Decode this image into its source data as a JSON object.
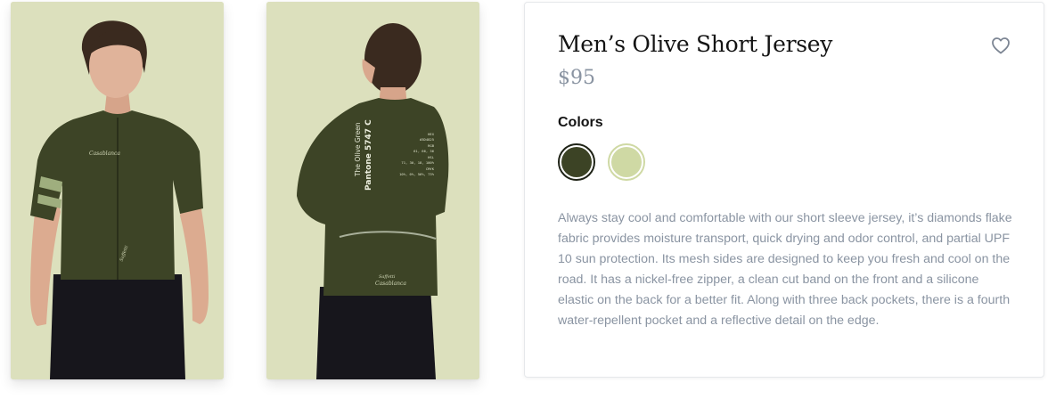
{
  "product": {
    "title": "Men’s Olive Short Jersey",
    "price": "$95",
    "colors_label": "Colors",
    "colors": [
      {
        "name": "olive",
        "hex": "#3c4325",
        "selected": true
      },
      {
        "name": "light-sage",
        "hex": "#cfd9a4",
        "selected": false
      }
    ],
    "description": "Always stay cool and comfortable with our short sleeve jersey, it’s diamonds flake fabric provides moisture transport, quick drying and odor control, and partial UPF 10 sun protection. Its mesh sides are designed to keep you fresh and cool on the road. It has a nickel-free zipper, a clean cut band on the front and a silicone elastic on the back for a better fit. Along with three back pockets, there is a fourth water-repellent pocket and a reflective detail on the edge.",
    "favorite_icon": "heart-outline-icon"
  },
  "images": {
    "front": {
      "chest_logo": "Casablanca",
      "hem_logo": "Saffetti"
    },
    "back": {
      "vertical_line1": "The Olive Green",
      "vertical_line2": "Pantone 5747 C",
      "spec_lines": [
        "HEX",
        "#3D4825",
        "RGB",
        "61, 66, 36",
        "HSL",
        "71, 30, 18, 100%",
        "CMYK",
        "10%, 0%, 56%, 73%"
      ],
      "pocket_logo1": "Saffetti",
      "pocket_logo2": "Casablanca"
    },
    "background": "#dce0bd",
    "jersey": "#3d4426"
  }
}
